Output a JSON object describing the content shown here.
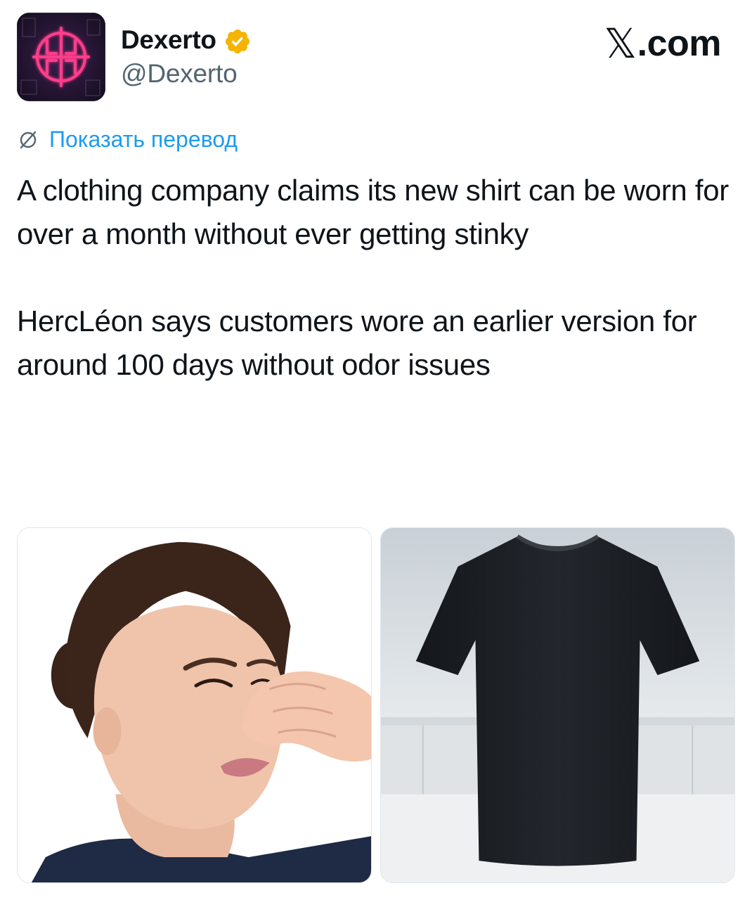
{
  "author": {
    "display_name": "Dexerto",
    "handle": "@Dexerto",
    "avatar_icon": "dexerto-logo-icon",
    "verified_icon": "verified-badge-icon",
    "verified_color": "#f4b400"
  },
  "brand": {
    "x_glyph": "𝕏",
    "suffix": ".com"
  },
  "translate": {
    "label": "Показать перевод",
    "icon": "globe-icon",
    "color": "#1d9bf0"
  },
  "tweet": {
    "paragraph_1": "A clothing company claims its new shirt can be worn for over a month without ever getting stinky",
    "paragraph_2": "HercLéon says customers wore an earlier version for around 100 days without odor issues"
  },
  "media": {
    "items": [
      {
        "name": "woman-holding-nose-image"
      },
      {
        "name": "black-tshirt-image"
      }
    ]
  }
}
